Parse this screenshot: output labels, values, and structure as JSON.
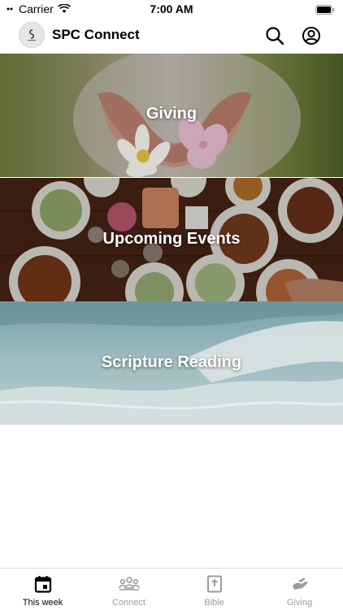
{
  "status_bar": {
    "carrier": "Carrier",
    "time": "7:00 AM",
    "wifi_icon": "wifi-icon",
    "battery_icon": "battery-icon"
  },
  "header": {
    "title": "SPC Connect",
    "logo_icon": "church-logo",
    "search_icon": "search-icon",
    "profile_icon": "user-circle-icon"
  },
  "tiles": [
    {
      "label": "Giving",
      "image": "hands holding flowers"
    },
    {
      "label": "Upcoming Events",
      "image": "shared meal on table"
    },
    {
      "label": "Scripture Reading",
      "image": "ocean wave"
    }
  ],
  "tab_bar": {
    "tabs": [
      {
        "label": "This week",
        "icon": "calendar-icon",
        "active": true
      },
      {
        "label": "Connect",
        "icon": "group-icon",
        "active": false
      },
      {
        "label": "Bible",
        "icon": "bible-icon",
        "active": false
      },
      {
        "label": "Giving",
        "icon": "hand-offering-icon",
        "active": false
      }
    ]
  },
  "colors": {
    "tab_active": "#000000",
    "tab_inactive": "#9b9b9b",
    "header_text": "#000000"
  }
}
